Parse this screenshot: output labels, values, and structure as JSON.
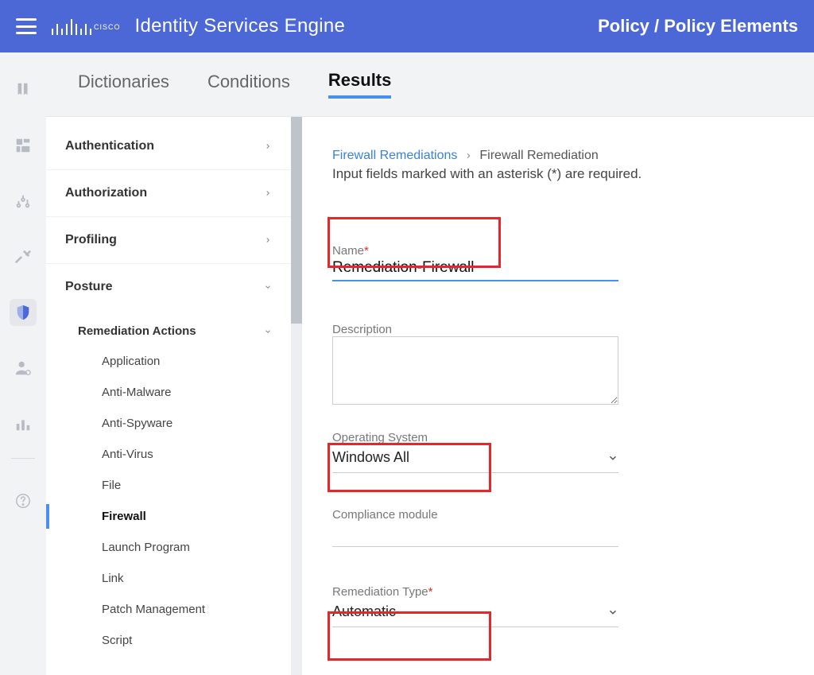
{
  "app_title": "Identity Services Engine",
  "breadcrumb_top": "Policy / Policy Elements",
  "tabs": {
    "dictionaries": "Dictionaries",
    "conditions": "Conditions",
    "results": "Results"
  },
  "tree": {
    "authentication": "Authentication",
    "authorization": "Authorization",
    "profiling": "Profiling",
    "posture": "Posture",
    "remediation_actions": "Remediation Actions",
    "items": {
      "application": "Application",
      "anti_malware": "Anti-Malware",
      "anti_spyware": "Anti-Spyware",
      "anti_virus": "Anti-Virus",
      "file": "File",
      "firewall": "Firewall",
      "launch_program": "Launch Program",
      "link": "Link",
      "patch_management": "Patch Management",
      "script": "Script"
    }
  },
  "form": {
    "crumb_parent": "Firewall Remediations",
    "crumb_current": "Firewall Remediation",
    "helper": "Input fields marked with an asterisk (*) are required.",
    "name_label": "Name",
    "name_value": "Remediation-Firewall",
    "description_label": "Description",
    "description_value": "",
    "os_label": "Operating System",
    "os_value": "Windows All",
    "compliance_label": "Compliance module",
    "compliance_value": "",
    "remtype_label": "Remediation Type",
    "remtype_value": "Automatic"
  }
}
